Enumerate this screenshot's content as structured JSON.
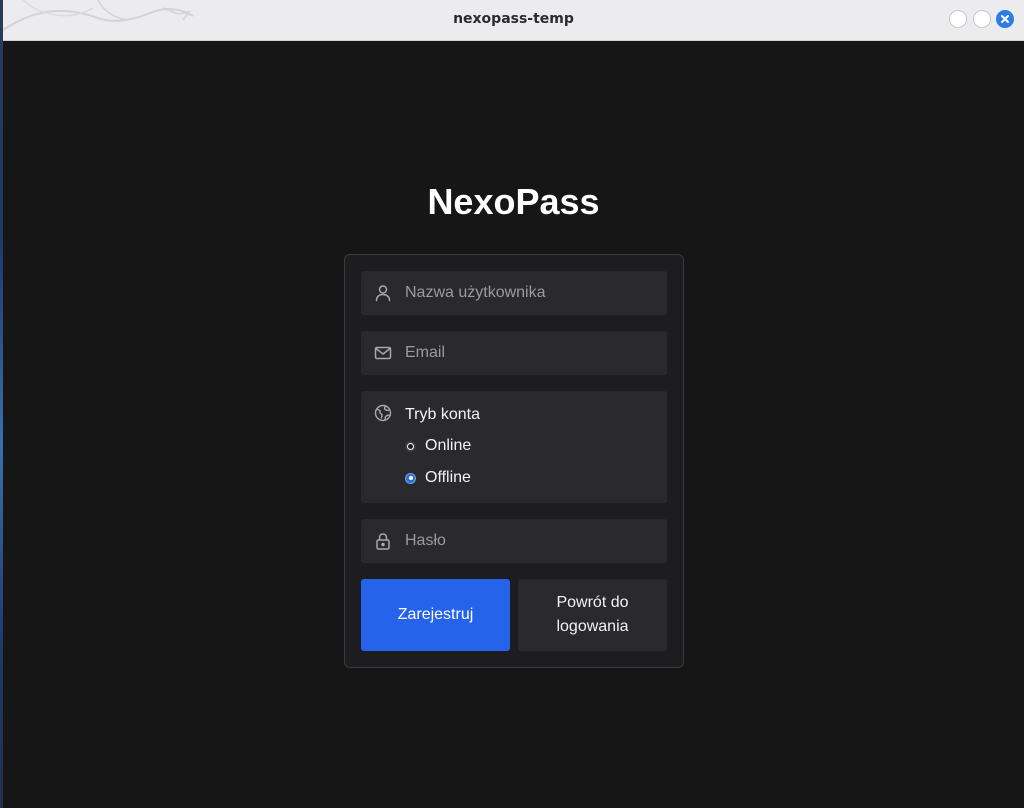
{
  "window": {
    "title": "nexopass-temp"
  },
  "app": {
    "title": "NexoPass"
  },
  "form": {
    "username": {
      "placeholder": "Nazwa użytkownika",
      "value": ""
    },
    "email": {
      "placeholder": "Email",
      "value": ""
    },
    "account_mode": {
      "label": "Tryb konta",
      "options": [
        {
          "label": "Online",
          "selected": false
        },
        {
          "label": "Offline",
          "selected": true
        }
      ]
    },
    "password": {
      "placeholder": "Hasło",
      "value": ""
    },
    "register_label": "Zarejestruj",
    "back_label": "Powrót do logowania"
  },
  "icons": {
    "username": "user-icon",
    "email": "mail-icon",
    "account_mode": "globe-icon",
    "password": "lock-icon",
    "close": "close-icon"
  },
  "colors": {
    "background": "#161617",
    "card": "#1d1d1f",
    "field": "#2a2a2c",
    "primary": "#2563eb",
    "titlebar": "#ececef",
    "close_button": "#2f7be6"
  }
}
